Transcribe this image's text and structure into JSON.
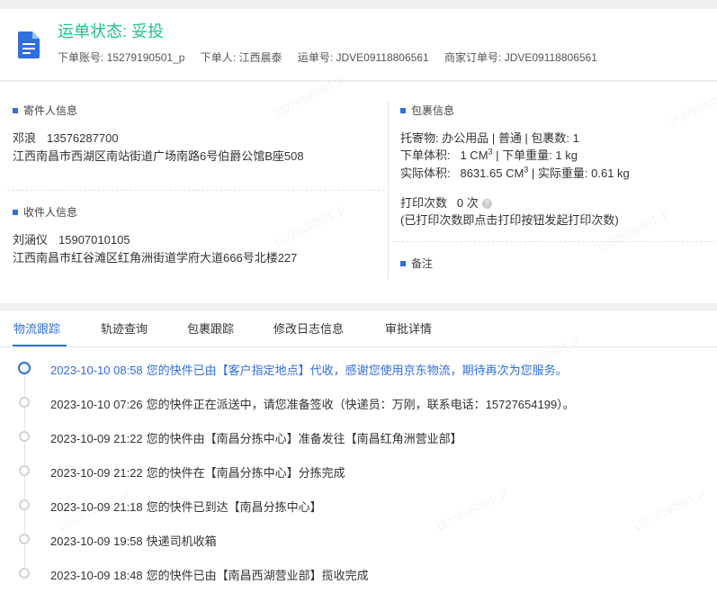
{
  "header": {
    "status_prefix": "运单状态: ",
    "status_value": "妥投",
    "meta": [
      {
        "label": "下单账号: ",
        "value": "15279190501_p"
      },
      {
        "label": "下单人: ",
        "value": "江西晨泰"
      },
      {
        "label": "运单号: ",
        "value": "JDVE09118806561"
      },
      {
        "label": "商家订单号: ",
        "value": "JDVE09118806561"
      }
    ]
  },
  "sender": {
    "title": "寄件人信息",
    "name": "邓浪",
    "phone": "13576287700",
    "address": "江西南昌市西湖区南站街道广场南路6号伯爵公馆B座508"
  },
  "receiver": {
    "title": "收件人信息",
    "name": "刘涵仪",
    "phone": "15907010105",
    "address": "江西南昌市红谷滩区红角洲街道学府大道666号北楼227"
  },
  "package": {
    "title": "包裹信息",
    "line1": "托寄物:  办公用品 | 普通  |  包裹数:  1",
    "order_volume_label": "下单体积:",
    "order_volume_value": "1 CM",
    "order_weight": " |  下单重量:  1 kg",
    "actual_volume_label": "实际体积:",
    "actual_volume_value": "8631.65 CM",
    "actual_weight": " |  实际重量:  0.61 kg",
    "superscript": "3",
    "print_label": "打印次数",
    "print_count": "0 次",
    "help_glyph": "?",
    "print_note": "(已打印次数即点击打印按钮发起打印次数)"
  },
  "remark": {
    "title": "备注"
  },
  "tabs": [
    {
      "label": "物流跟踪",
      "active": true
    },
    {
      "label": "轨迹查询",
      "active": false
    },
    {
      "label": "包裹跟踪",
      "active": false
    },
    {
      "label": "修改日志信息",
      "active": false
    },
    {
      "label": "审批详情",
      "active": false
    }
  ],
  "timeline": [
    {
      "time": "2023-10-10 08:58",
      "text": "您的快件已由【客户指定地点】代收，感谢您使用京东物流，期待再次为您服务。",
      "active": true
    },
    {
      "time": "2023-10-10 07:26",
      "text": "您的快件正在派送中，请您准备签收（快递员：万刚，联系电话：15727654199）。",
      "active": false
    },
    {
      "time": "2023-10-09 21:22",
      "text": "您的快件由【南昌分拣中心】准备发往【南昌红角洲营业部】",
      "active": false
    },
    {
      "time": "2023-10-09 21:22",
      "text": "您的快件在【南昌分拣中心】分拣完成",
      "active": false
    },
    {
      "time": "2023-10-09 21:18",
      "text": "您的快件已到达【南昌分拣中心】",
      "active": false
    },
    {
      "time": "2023-10-09 19:58",
      "text": "快递司机收箱",
      "active": false
    },
    {
      "time": "2023-10-09 18:48",
      "text": "您的快件已由【南昌西湖营业部】揽收完成",
      "active": false
    }
  ],
  "watermark_text": "15279190501_p",
  "colors": {
    "accent": "#2f6fe0",
    "status_green": "#1ec08a"
  },
  "icons": {
    "header": "document-icon",
    "help": "question-circle-icon"
  }
}
